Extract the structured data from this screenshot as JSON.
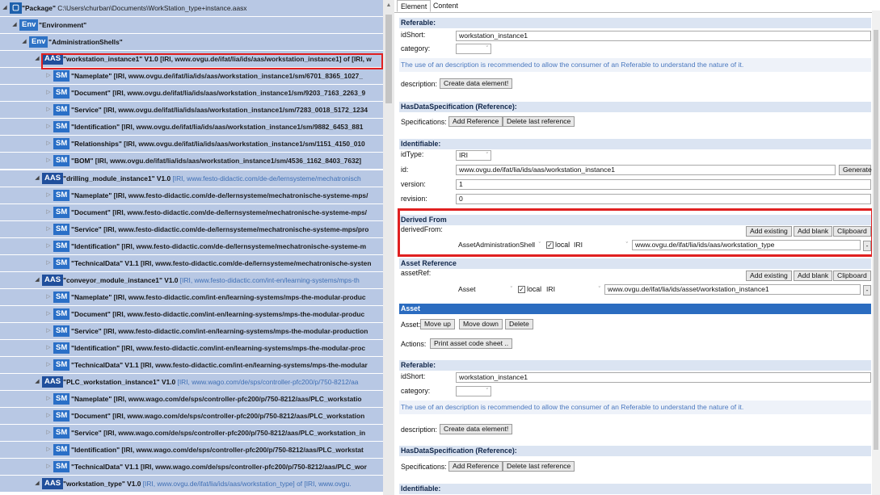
{
  "tree": {
    "rows": [
      {
        "badge": "▢",
        "kind": "pkg",
        "name": "\"Package\"",
        "rest": " C:\\Users\\churban\\Documents\\WorkStation_type+instance.aasx"
      },
      {
        "badge": "Env",
        "kind": "env",
        "name": "\"Environment\"",
        "rest": ""
      },
      {
        "badge": "Env",
        "kind": "env",
        "name": "\"AdministrationShells\"",
        "rest": ""
      },
      {
        "badge": "AAS",
        "kind": "aas",
        "name": "\"workstation_instance1\" V1.0",
        "rest": " [IRI, www.ovgu.de/ifat/lia/ids/aas/workstation_instance1] of [IRI, w"
      },
      {
        "badge": "SM",
        "kind": "sm",
        "name": "\"Nameplate\"",
        "rest": " [IRI, www.ovgu.de/ifat/lia/ids/aas/workstation_instance1/sm/6701_8365_1027_"
      },
      {
        "badge": "SM",
        "kind": "sm",
        "name": "\"Document\"",
        "rest": " [IRI, www.ovgu.de/ifat/lia/ids/aas/workstation_instance1/sm/9203_7163_2263_9"
      },
      {
        "badge": "SM",
        "kind": "sm",
        "name": "\"Service\"",
        "rest": " [IRI, www.ovgu.de/ifat/lia/ids/aas/workstation_instance1/sm/7283_0018_5172_1234"
      },
      {
        "badge": "SM",
        "kind": "sm",
        "name": "\"Identification\"",
        "rest": " [IRI, www.ovgu.de/ifat/lia/ids/aas/workstation_instance1/sm/9882_6453_881"
      },
      {
        "badge": "SM",
        "kind": "sm",
        "name": "\"Relationships\"",
        "rest": " [IRI, www.ovgu.de/ifat/lia/ids/aas/workstation_instance1/sm/1151_4150_010"
      },
      {
        "badge": "SM",
        "kind": "sm",
        "name": "\"BOM\"",
        "rest": " [IRI, www.ovgu.de/ifat/lia/ids/aas/workstation_instance1/sm/4536_1162_8403_7632]"
      },
      {
        "badge": "AAS",
        "kind": "aas",
        "name": "\"drilling_module_instance1\" V1.0",
        "rest": " [IRI, www.festo-didactic.com/de-de/lernsysteme/mechatronisch"
      },
      {
        "badge": "SM",
        "kind": "sm",
        "name": "\"Nameplate\"",
        "rest": " [IRI, www.festo-didactic.com/de-de/lernsysteme/mechatronische-systeme-mps/"
      },
      {
        "badge": "SM",
        "kind": "sm",
        "name": "\"Document\"",
        "rest": " [IRI, www.festo-didactic.com/de-de/lernsysteme/mechatronische-systeme-mps/"
      },
      {
        "badge": "SM",
        "kind": "sm",
        "name": "\"Service\"",
        "rest": " [IRI, www.festo-didactic.com/de-de/lernsysteme/mechatronische-systeme-mps/pro"
      },
      {
        "badge": "SM",
        "kind": "sm",
        "name": "\"Identification\"",
        "rest": " [IRI, www.festo-didactic.com/de-de/lernsysteme/mechatronische-systeme-m"
      },
      {
        "badge": "SM",
        "kind": "sm",
        "name": "\"TechnicalData\" V1.1",
        "rest": " [IRI, www.festo-didactic.com/de-de/lernsysteme/mechatronische-systen"
      },
      {
        "badge": "AAS",
        "kind": "aas",
        "name": "\"conveyor_module_instance1\" V1.0",
        "rest": " [IRI, www.festo-didactic.com/int-en/learning-systems/mps-th"
      },
      {
        "badge": "SM",
        "kind": "sm",
        "name": "\"Nameplate\"",
        "rest": " [IRI, www.festo-didactic.com/int-en/learning-systems/mps-the-modular-produc"
      },
      {
        "badge": "SM",
        "kind": "sm",
        "name": "\"Document\"",
        "rest": " [IRI, www.festo-didactic.com/int-en/learning-systems/mps-the-modular-produc"
      },
      {
        "badge": "SM",
        "kind": "sm",
        "name": "\"Service\"",
        "rest": " [IRI, www.festo-didactic.com/int-en/learning-systems/mps-the-modular-production"
      },
      {
        "badge": "SM",
        "kind": "sm",
        "name": "\"Identification\"",
        "rest": " [IRI, www.festo-didactic.com/int-en/learning-systems/mps-the-modular-proc"
      },
      {
        "badge": "SM",
        "kind": "sm",
        "name": "\"TechnicalData\" V1.1",
        "rest": " [IRI, www.festo-didactic.com/int-en/learning-systems/mps-the-modular"
      },
      {
        "badge": "AAS",
        "kind": "aas",
        "name": "\"PLC_workstation_instance1\" V1.0",
        "rest": " [IRI, www.wago.com/de/sps/controller-pfc200/p/750-8212/aa"
      },
      {
        "badge": "SM",
        "kind": "sm",
        "name": "\"Nameplate\"",
        "rest": " [IRI, www.wago.com/de/sps/controller-pfc200/p/750-8212/aas/PLC_workstatio"
      },
      {
        "badge": "SM",
        "kind": "sm",
        "name": "\"Document\"",
        "rest": " [IRI, www.wago.com/de/sps/controller-pfc200/p/750-8212/aas/PLC_workstation"
      },
      {
        "badge": "SM",
        "kind": "sm",
        "name": "\"Service\"",
        "rest": " [IRI, www.wago.com/de/sps/controller-pfc200/p/750-8212/aas/PLC_workstation_in"
      },
      {
        "badge": "SM",
        "kind": "sm",
        "name": "\"Identification\"",
        "rest": " [IRI, www.wago.com/de/sps/controller-pfc200/p/750-8212/aas/PLC_workstat"
      },
      {
        "badge": "SM",
        "kind": "sm",
        "name": "\"TechnicalData\" V1.1",
        "rest": " [IRI, www.wago.com/de/sps/controller-pfc200/p/750-8212/aas/PLC_wor"
      },
      {
        "badge": "AAS",
        "kind": "aas",
        "name": "\"workstation_type\" V1.0",
        "rest": " [IRI, www.ovgu.de/ifat/lia/ids/aas/workstation_type] of [IRI, www.ovgu."
      }
    ]
  },
  "tabs": {
    "element": "Element",
    "content": "Content"
  },
  "referable1": {
    "header": "Referable:",
    "idshort_label": "idShort:",
    "idshort_value": "workstation_instance1",
    "category_label": "category:",
    "hint": "The use of an description is recommended to allow the consumer of an Referable to understand the nature of it.",
    "description_label": "description:",
    "create_button": "Create data element!"
  },
  "hasdataspec1": {
    "header": "HasDataSpecification (Reference):",
    "spec_label": "Specifications:",
    "add_ref": "Add Reference",
    "delete_ref": "Delete last reference"
  },
  "identifiable": {
    "header": "Identifiable:",
    "idtype_label": "idType:",
    "idtype_value": "IRI",
    "id_label": "id:",
    "id_value": "www.ovgu.de/ifat/lia/ids/aas/workstation_instance1",
    "generate": "Generate",
    "version_label": "version:",
    "version_value": "1",
    "revision_label": "revision:",
    "revision_value": "0"
  },
  "derived": {
    "header": "Derived From",
    "label": "derivedFrom:",
    "add_existing": "Add existing",
    "add_blank": "Add blank",
    "clipboard": "Clipboard",
    "type_value": "AssetAdministrationShell",
    "local_label": "local",
    "idtype_value": "IRI",
    "value": "www.ovgu.de/ifat/lia/ids/aas/workstation_type",
    "more": "-"
  },
  "assetref": {
    "header": "Asset Reference",
    "label": "assetRef:",
    "add_existing": "Add existing",
    "add_blank": "Add blank",
    "clipboard": "Clipboard",
    "type_value": "Asset",
    "local_label": "local",
    "idtype_value": "IRI",
    "value": "www.ovgu.de/ifat/lia/ids/asset/workstation_instance1",
    "more": "-"
  },
  "asset": {
    "header": "Asset",
    "asset_label": "Asset:",
    "move_up": "Move up",
    "move_down": "Move down",
    "delete": "Delete",
    "actions_label": "Actions:",
    "print_button": "Print asset code sheet .."
  },
  "referable2": {
    "header": "Referable:",
    "idshort_label": "idShort:",
    "idshort_value": "workstation_instance1",
    "category_label": "category:",
    "hint": "The use of an description is recommended to allow the consumer of an Referable to understand the nature of it.",
    "description_label": "description:",
    "create_button": "Create data element!"
  },
  "hasdataspec2": {
    "header": "HasDataSpecification (Reference):",
    "spec_label": "Specifications:",
    "add_ref": "Add Reference",
    "delete_ref": "Delete last reference"
  },
  "identifiable2": {
    "header": "Identifiable:"
  },
  "icons": {
    "expanded": "◢",
    "collapsed": "▷",
    "dropdown": "˅",
    "check": "✓"
  },
  "colors": {
    "tree_bg": "#b8c8e4",
    "badge_aas": "#204f9c",
    "badge_sm": "#2a6fc7",
    "highlight": "#e02020",
    "section_header": "#dbe4f2",
    "hint_text": "#4a78bf"
  }
}
